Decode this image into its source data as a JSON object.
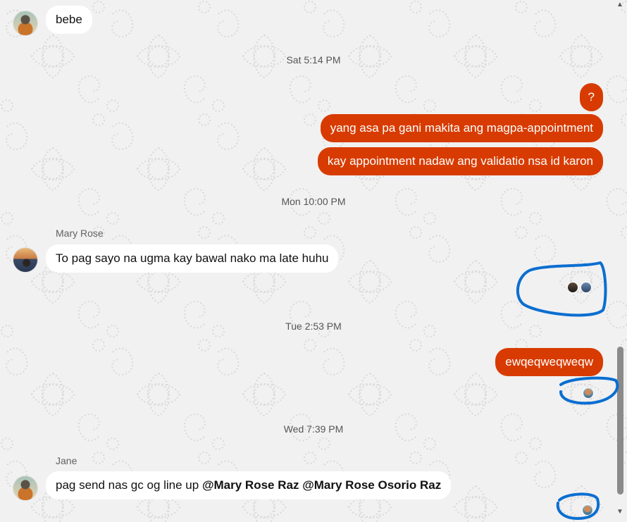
{
  "messages": {
    "bebe": {
      "text": "bebe"
    },
    "sat_time": "Sat 5:14 PM",
    "question": {
      "text": "?"
    },
    "out_1": {
      "text": "yang asa pa gani makita ang magpa-appointment"
    },
    "out_2": {
      "text": "kay appointment nadaw ang validatio nsa id karon"
    },
    "mon_time": "Mon 10:00 PM",
    "mary_name": "Mary Rose",
    "mary_msg": {
      "text": "To pag sayo na ugma kay bawal nako ma late huhu"
    },
    "tue_time": "Tue 2:53 PM",
    "out_3": {
      "text": "ewqeqweqweqw"
    },
    "wed_time": "Wed 7:39 PM",
    "jane_name": "Jane",
    "jane_msg": {
      "text_before": "pag send nas gc og line up ",
      "mention_1": "@Mary Rose Raz",
      "spacer": " ",
      "mention_2": "@Mary Rose Osorio Raz"
    }
  },
  "icons": {
    "avatar_jane": "avatar-photo-icon",
    "avatar_mary": "avatar-photo-icon",
    "read_receipt": "read-receipt-avatar-icon",
    "scroll_up": "chevron-up-icon",
    "scroll_down": "chevron-down-icon"
  },
  "colors": {
    "outgoing_bubble": "#d83b01",
    "incoming_bubble": "#ffffff",
    "annotation_ink": "#0a6ed1",
    "background": "#f1f1f1"
  }
}
